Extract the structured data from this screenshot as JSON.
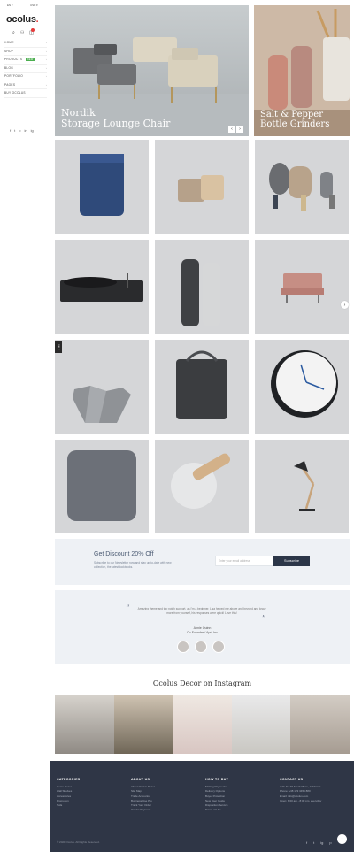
{
  "top_selectors": {
    "language": "EN",
    "currency": "USD"
  },
  "logo": {
    "text": "ocolus",
    "dot": "."
  },
  "header_icons": [
    "search-icon",
    "user-icon",
    "cart-icon"
  ],
  "menu": [
    {
      "label": "Home",
      "has_arrow": true
    },
    {
      "label": "Shop",
      "has_arrow": true
    },
    {
      "label": "Products",
      "badge": "NEW",
      "has_arrow": true
    },
    {
      "label": "Blog",
      "has_arrow": true
    },
    {
      "label": "Portfolio",
      "has_arrow": true
    },
    {
      "label": "Pages",
      "has_arrow": true
    },
    {
      "label": "Buy Ocolus",
      "has_arrow": false
    }
  ],
  "social_icons": [
    "f",
    "t",
    "p",
    "in",
    "ig"
  ],
  "hero": {
    "left_title_line1": "Nordik",
    "left_title_line2": "Storage Lounge Chair",
    "right_title_line1": "Salt & Pepper",
    "right_title_line2": "Bottle Grinders",
    "prev": "‹",
    "next": "›"
  },
  "grid_side_tag": "SALE",
  "discount": {
    "title": "Get Discount 20% Off",
    "subtitle": "Subscribe to our Newsletter now and stay up-to-date with new collection, the latest lookbooks.",
    "placeholder": "Enter your email address",
    "button": "Subscribe"
  },
  "testimonial": {
    "quote_open": "“",
    "quote_close": "”",
    "text": "Amazing theme and top notch support, as I'm a beginner, Lisa helped me above and beyond and know more from yourself, his responses were quick! Love this!",
    "name": "Annie Quinn",
    "role": "Co-Founder / April Inc"
  },
  "instagram_title": "Ocolus Decor on Instagram",
  "footer": {
    "columns": [
      {
        "title": "CATEGORIES",
        "items": [
          "Home Decor",
          "Wall Shelves",
          "Accessories",
          "Promotion",
          "Sofa"
        ]
      },
      {
        "title": "ABOUT US",
        "items": [
          "About Ocolus Decor",
          "Site Map",
          "Trade Accounts",
          "Business Use Pro",
          "Track Your Order",
          "Vendor Payment"
        ]
      },
      {
        "title": "HOW TO BUY",
        "items": [
          "Making Payments",
          "Delivery Options",
          "Buyer Protection",
          "New User Guide",
          "Disposition Service",
          "Terms of Use"
        ]
      },
      {
        "title": "CONTACT US",
        "items": [
          "Add: No 36 South Place, California",
          "Phone: +38 123 3456 880",
          "Email: info@ocolus.com",
          "Open: 8:00 am - 8:00 pm, everyday"
        ]
      }
    ],
    "copyright": "© 2021 Ocolus. All Rights Reserved.",
    "social": [
      "f",
      "t",
      "ig",
      "p"
    ],
    "to_top": "↑"
  },
  "colors": {
    "accent": "#e63b3b",
    "footer_bg": "#2f3646",
    "panel_bg": "#eef1f5",
    "button_dark": "#2c3648"
  }
}
